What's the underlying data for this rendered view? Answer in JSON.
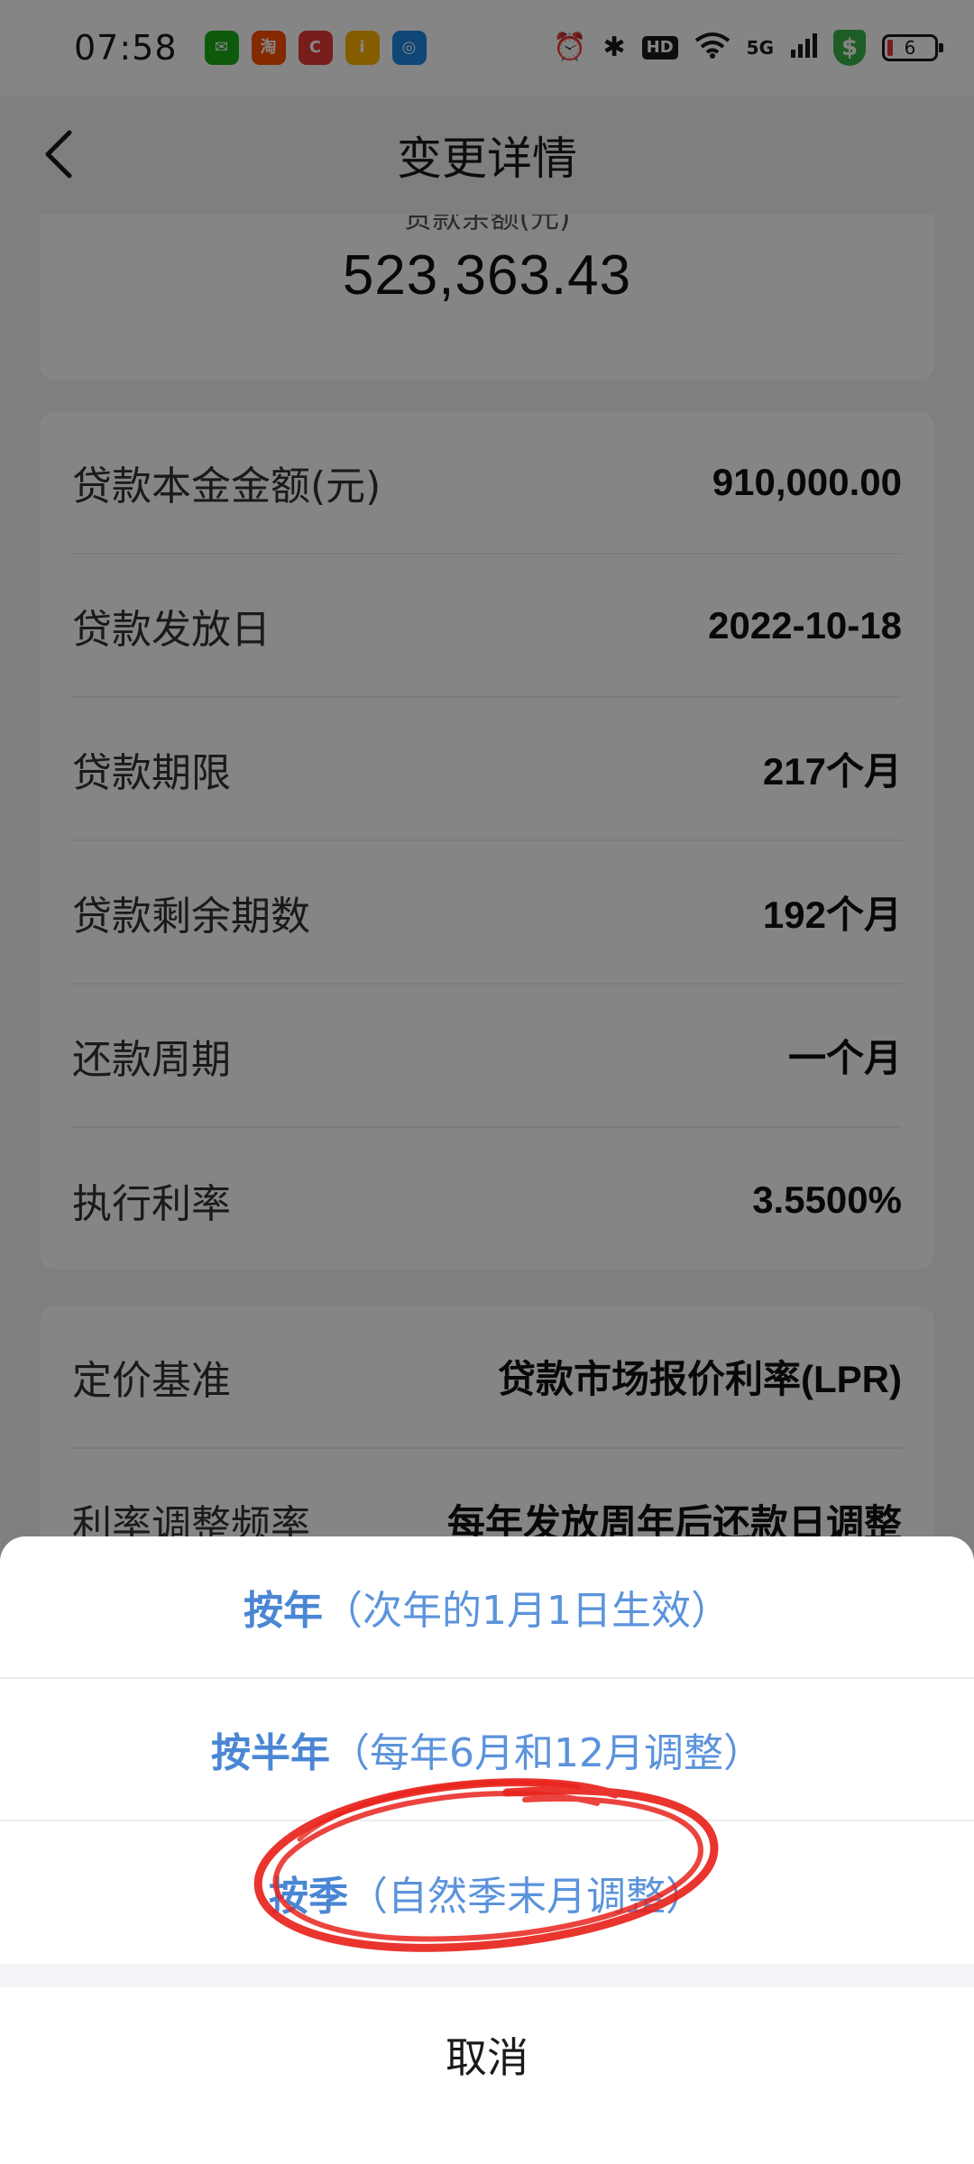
{
  "status_bar": {
    "time": "07:58",
    "app_icons": [
      {
        "name": "wechat-icon",
        "glyph": "✉",
        "color": "#1aad19"
      },
      {
        "name": "taobao-icon",
        "glyph": "淘",
        "color": "#ff5000"
      },
      {
        "name": "ctrip-icon",
        "glyph": "C",
        "color": "#e53935"
      },
      {
        "name": "imou-icon",
        "glyph": "i",
        "color": "#ffb300"
      },
      {
        "name": "alipay-icon",
        "glyph": "◎",
        "color": "#1e88e5"
      }
    ],
    "hd_label": "HD",
    "network_label": "5G",
    "battery_level": "6"
  },
  "nav": {
    "title": "变更详情"
  },
  "balance": {
    "label": "贷款余额(元)",
    "value": "523,363.43"
  },
  "details": [
    {
      "label": "贷款本金金额(元)",
      "value": "910,000.00"
    },
    {
      "label": "贷款发放日",
      "value": "2022-10-18"
    },
    {
      "label": "贷款期限",
      "value": "217个月"
    },
    {
      "label": "贷款剩余期数",
      "value": "192个月"
    },
    {
      "label": "还款周期",
      "value": "一个月"
    },
    {
      "label": "执行利率",
      "value": "3.5500%"
    }
  ],
  "pricing": [
    {
      "label": "定价基准",
      "value": "贷款市场报价利率(LPR)"
    },
    {
      "label": "利率调整频率",
      "value": "每年发放周年后还款日调整"
    }
  ],
  "sheet": {
    "options": [
      {
        "main": "按年",
        "sub": "（次年的1月1日生效）"
      },
      {
        "main": "按半年",
        "sub": "（每年6月和12月调整）"
      },
      {
        "main": "按季",
        "sub": "（自然季末月调整）"
      }
    ],
    "cancel": "取消"
  },
  "colors": {
    "accent": "#4a86d4",
    "annotation": "#e8231c"
  }
}
